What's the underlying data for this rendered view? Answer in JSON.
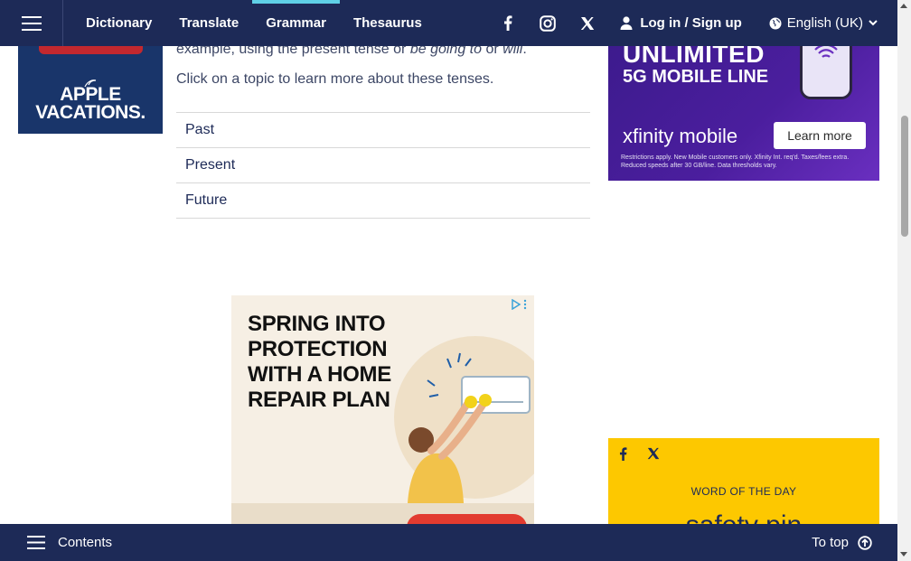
{
  "nav": {
    "links": [
      {
        "label": "Dictionary"
      },
      {
        "label": "Translate"
      },
      {
        "label": "Grammar"
      },
      {
        "label": "Thesaurus"
      }
    ],
    "active_link": "Grammar",
    "login": "Log in / Sign up",
    "language": "English (UK)",
    "social_icons": [
      "facebook-icon",
      "instagram-icon",
      "x-icon"
    ]
  },
  "left_ad": {
    "brand_line1": "APPLE",
    "brand_line2": "VACATIONS."
  },
  "main": {
    "intro_before": "example, using the present tense or ",
    "intro_em1": "be going to",
    "intro_mid": " or ",
    "intro_em2": "will",
    "intro_after": ".",
    "click_text": "Click on a topic to learn more about these tenses.",
    "topics": [
      {
        "label": "Past"
      },
      {
        "label": "Present"
      },
      {
        "label": "Future"
      }
    ]
  },
  "center_ad": {
    "headline_lines": [
      "SPRING INTO",
      "PROTECTION",
      "WITH A HOME",
      "REPAIR PLAN"
    ]
  },
  "right_ad": {
    "line1": "UNLIMITED",
    "line2": "5G MOBILE LINE",
    "brand": "xfinity mobile",
    "button": "Learn more",
    "fine_print": "Restrictions apply. New Mobile customers only. Xfinity Int. req'd. Taxes/fees extra. Reduced speeds after 30 GB/line. Data thresholds vary."
  },
  "word_of_the_day": {
    "label": "WORD OF THE DAY",
    "word": "safety pin"
  },
  "bottom_bar": {
    "contents": "Contents",
    "to_top": "To top"
  },
  "colors": {
    "navy": "#1d2a57",
    "accent_cyan": "#5fd0e6",
    "wotd_yellow": "#fdc800"
  }
}
